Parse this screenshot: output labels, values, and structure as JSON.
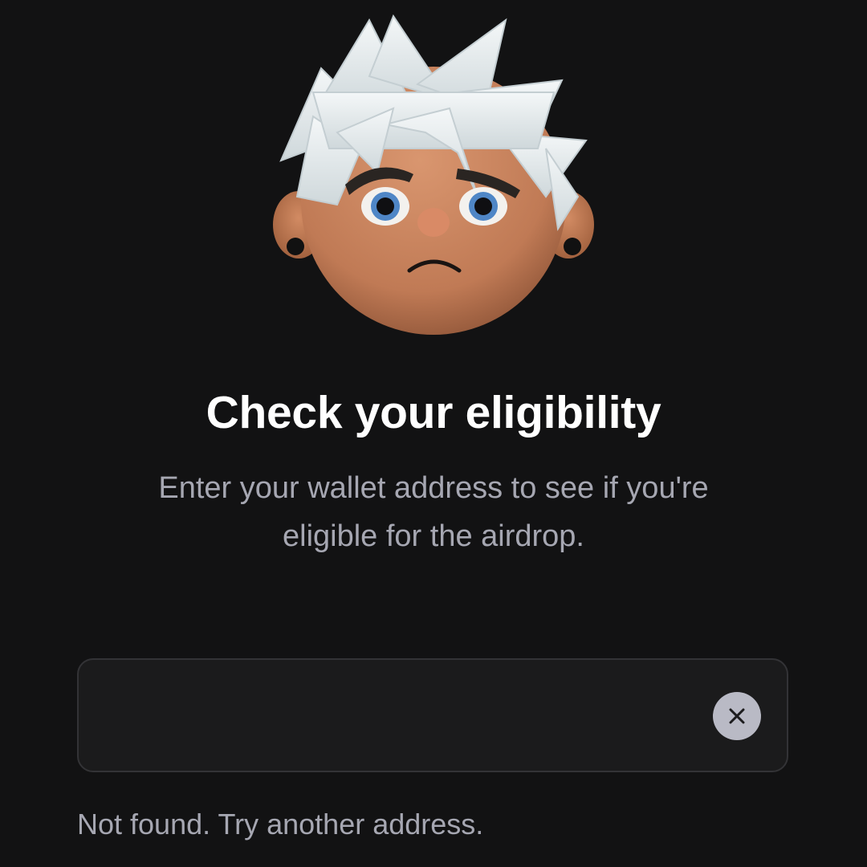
{
  "avatar": {
    "icon": "sad-avatar-icon",
    "colors": {
      "hair": "#e6ecee",
      "skin": "#c98560",
      "brow": "#2a2522",
      "iris": "#4f86c6"
    }
  },
  "header": {
    "title": "Check your eligibility",
    "subtitle": "Enter your wallet address to see if you're eligible for the airdrop."
  },
  "address_field": {
    "value": "",
    "placeholder": "",
    "clear_icon": "close-icon"
  },
  "status": {
    "message": "Not found. Try another address."
  },
  "colors": {
    "background": "#121213",
    "field_background": "#1b1b1c",
    "field_border": "#333336",
    "muted_text": "#a6a7b2",
    "clear_button": "#b9bac5"
  }
}
